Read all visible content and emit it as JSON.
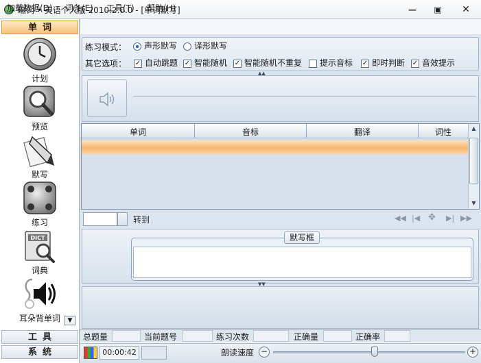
{
  "window": {
    "title": "瑞词 • 英语个人版 2010.2.0.0 - [单词默写]",
    "min_glyph": "—",
    "max_glyph": "▣",
    "close_glyph": "✕"
  },
  "menu": {
    "items": [
      "加载数据(D)",
      "词条(E)",
      "工具(T)",
      "帮助(H)"
    ]
  },
  "sidebar": {
    "word_header": "单词",
    "tools_header": "工具",
    "system_header": "系统",
    "items": [
      {
        "label": "计划",
        "icon": "clock-icon"
      },
      {
        "label": "预览",
        "icon": "magnifier-icon"
      },
      {
        "label": "默写",
        "icon": "pen-icon"
      },
      {
        "label": "练习",
        "icon": "practice-icon"
      },
      {
        "label": "词典",
        "icon": "dictionary-icon"
      },
      {
        "label": "耳朵背单词",
        "icon": "speaker-icon"
      }
    ]
  },
  "options": {
    "mode_label": "练习模式：",
    "mode_sound": "声形默写",
    "mode_translation": "译形默写",
    "selected_mode": "声形默写",
    "other_label": "其它选项：",
    "checkboxes": [
      {
        "label": "自动跳题",
        "checked": true
      },
      {
        "label": "智能随机",
        "checked": true
      },
      {
        "label": "智能随机不重复",
        "checked": true
      },
      {
        "label": "提示音标",
        "checked": false
      },
      {
        "label": "即时判断",
        "checked": true
      },
      {
        "label": "音效提示",
        "checked": true
      }
    ]
  },
  "table": {
    "columns": [
      "单词",
      "音标",
      "翻译",
      "词性"
    ],
    "rows": []
  },
  "navigation": {
    "goto_label": "转到",
    "goto_value": ""
  },
  "dictation": {
    "frame_label": "默写框",
    "value": ""
  },
  "stats": {
    "total_label": "总题量",
    "current_label": "当前题号",
    "practice_count_label": "练习次数",
    "correct_label": "正确量",
    "accuracy_label": "正确率"
  },
  "status": {
    "timer": "00:00:42",
    "speed_label": "朗读速度",
    "speed_level": 0.53
  },
  "colors": {
    "accent_orange": "#f7b673",
    "panel_blue": "#dce5ef"
  }
}
